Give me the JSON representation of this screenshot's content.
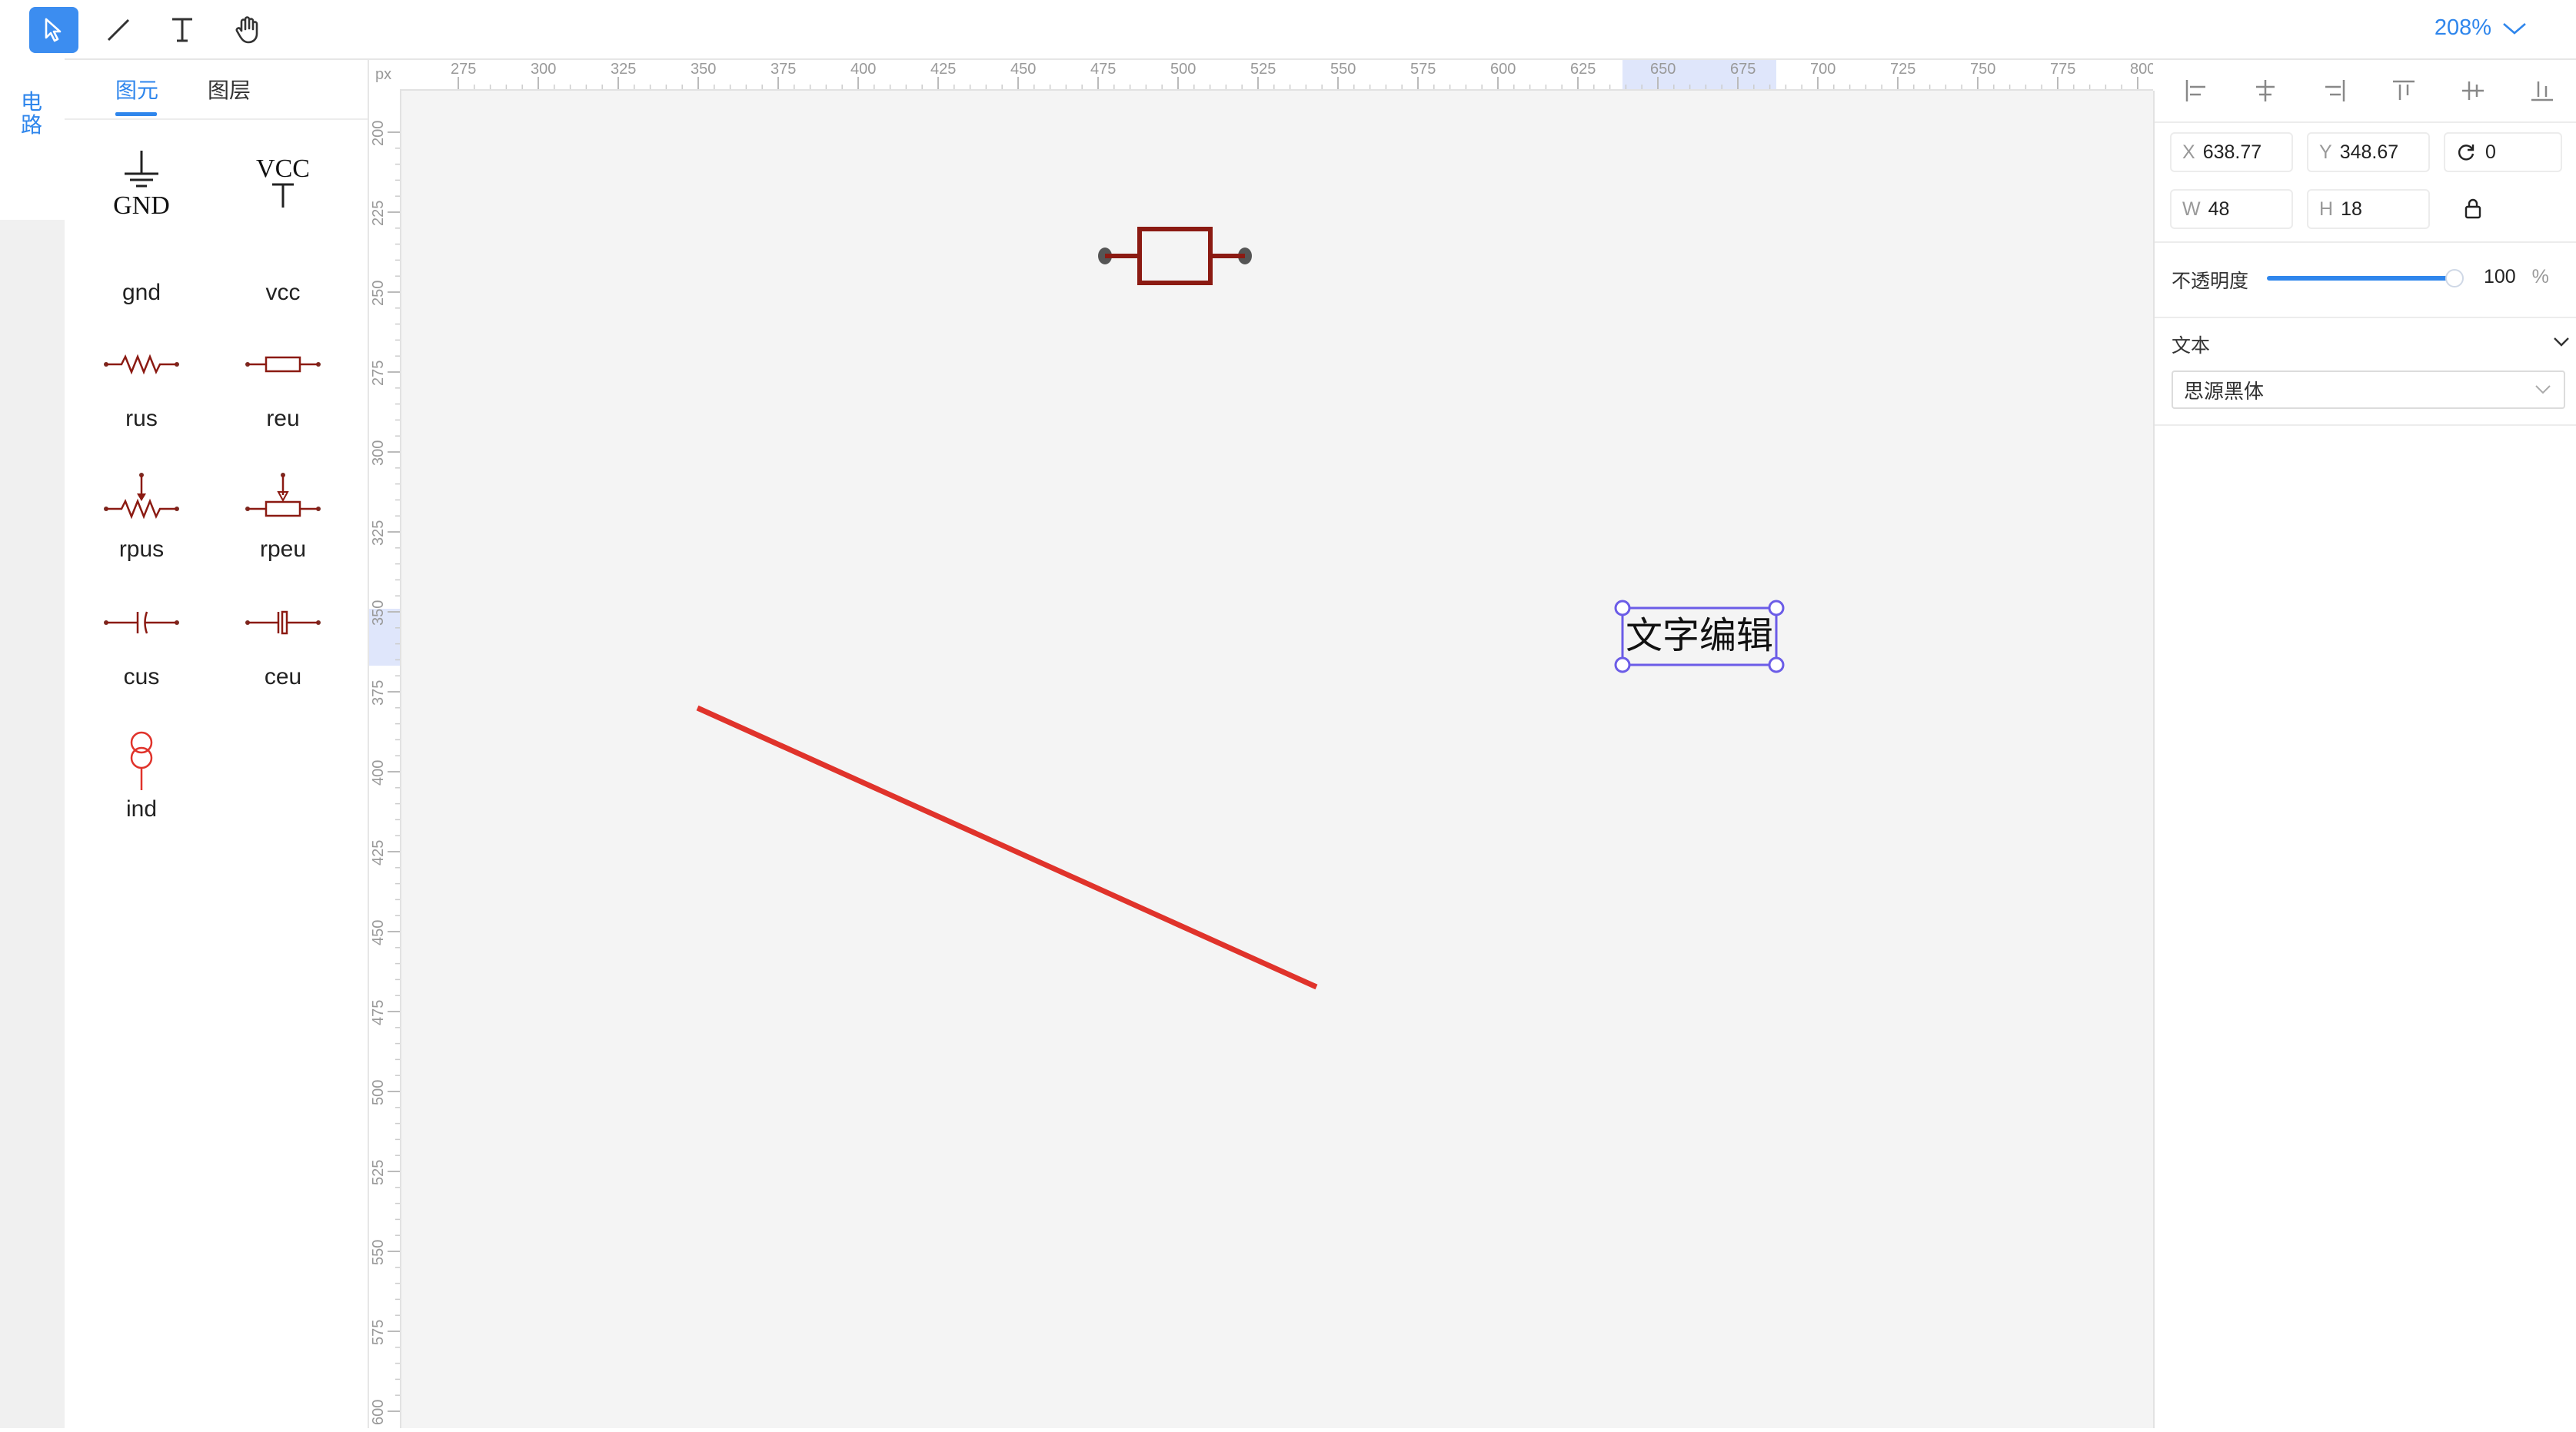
{
  "toolbar": {
    "tools": [
      {
        "name": "select-tool",
        "icon": "cursor-arrow-icon",
        "active": true
      },
      {
        "name": "line-tool",
        "icon": "line-icon",
        "active": false
      },
      {
        "name": "text-tool",
        "icon": "text-T-icon",
        "active": false
      },
      {
        "name": "pan-tool",
        "icon": "hand-icon",
        "active": false
      }
    ],
    "zoom": "208%"
  },
  "sidebar": {
    "category_tab": "电路"
  },
  "palette": {
    "tabs": [
      "图元",
      "图层"
    ],
    "active_tab": "图元",
    "symbols": [
      {
        "id": "gnd",
        "label": "gnd",
        "glyph_text": "GND"
      },
      {
        "id": "vcc",
        "label": "vcc",
        "glyph_text": "VCC"
      },
      {
        "id": "rus",
        "label": "rus"
      },
      {
        "id": "reu",
        "label": "reu"
      },
      {
        "id": "rpus",
        "label": "rpus"
      },
      {
        "id": "rpeu",
        "label": "rpeu"
      },
      {
        "id": "cus",
        "label": "cus"
      },
      {
        "id": "ceu",
        "label": "ceu"
      },
      {
        "id": "ind",
        "label": "ind"
      }
    ]
  },
  "rulers": {
    "unit": "px",
    "top_ticks": [
      "275",
      "300",
      "325",
      "350",
      "375",
      "400",
      "425",
      "450",
      "475",
      "500",
      "525",
      "550",
      "575",
      "600",
      "625",
      "650",
      "675",
      "700",
      "725",
      "750",
      "775",
      "800"
    ],
    "left_ticks": [
      "200",
      "225",
      "250",
      "275",
      "300",
      "325",
      "350",
      "375",
      "400",
      "425",
      "450",
      "475",
      "500",
      "525",
      "550",
      "575",
      "600"
    ]
  },
  "canvas": {
    "text_element": "文字编辑",
    "line_color": "#e0332b",
    "component_color": "#8b1a12",
    "selection_color": "#6b5ce7"
  },
  "properties": {
    "x_label": "X",
    "x": "638.77",
    "y_label": "Y",
    "y": "348.67",
    "rotation": "0",
    "w_label": "W",
    "w": "48",
    "h_label": "H",
    "h": "18",
    "opacity_label": "不透明度",
    "opacity": "100",
    "opacity_unit": "%",
    "text_section": "文本",
    "font": "思源黑体"
  },
  "colors": {
    "accent": "#2f86ec",
    "panel_bg": "#f0f0f0",
    "canvas_bg": "#f4f4f4"
  }
}
